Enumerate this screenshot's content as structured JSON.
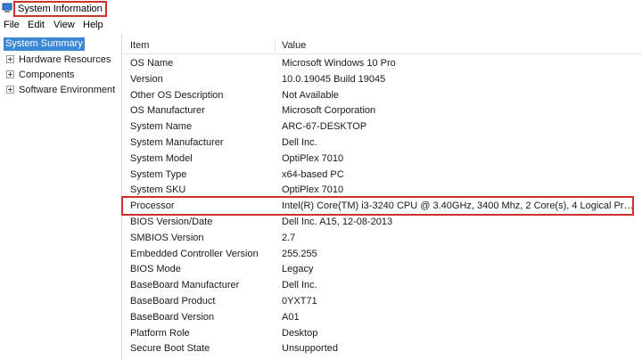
{
  "window": {
    "title": "System Information",
    "icon": "system-information-icon"
  },
  "menu": [
    {
      "label": "File"
    },
    {
      "label": "Edit"
    },
    {
      "label": "View"
    },
    {
      "label": "Help"
    }
  ],
  "tree": {
    "selected": "System Summary",
    "nodes": [
      {
        "label": "Hardware Resources"
      },
      {
        "label": "Components"
      },
      {
        "label": "Software Environment"
      }
    ]
  },
  "table": {
    "columns": [
      "Item",
      "Value"
    ],
    "rows": [
      [
        "OS Name",
        "Microsoft Windows 10 Pro"
      ],
      [
        "Version",
        "10.0.19045 Build 19045"
      ],
      [
        "Other OS Description",
        "Not Available"
      ],
      [
        "OS Manufacturer",
        "Microsoft Corporation"
      ],
      [
        "System Name",
        "ARC-67-DESKTOP"
      ],
      [
        "System Manufacturer",
        "Dell Inc."
      ],
      [
        "System Model",
        "OptiPlex 7010"
      ],
      [
        "System Type",
        "x64-based PC"
      ],
      [
        "System SKU",
        "OptiPlex 7010"
      ],
      [
        "Processor",
        "Intel(R) Core(TM) i3-3240 CPU @ 3.40GHz, 3400 Mhz, 2 Core(s), 4 Logical Pro..."
      ],
      [
        "BIOS Version/Date",
        "Dell Inc. A15, 12-08-2013"
      ],
      [
        "SMBIOS Version",
        "2.7"
      ],
      [
        "Embedded Controller Version",
        "255.255"
      ],
      [
        "BIOS Mode",
        "Legacy"
      ],
      [
        "BaseBoard Manufacturer",
        "Dell Inc."
      ],
      [
        "BaseBoard Product",
        "0YXT71"
      ],
      [
        "BaseBoard Version",
        "A01"
      ],
      [
        "Platform Role",
        "Desktop"
      ],
      [
        "Secure Boot State",
        "Unsupported"
      ]
    ]
  },
  "colors": {
    "highlight": "#d0312d",
    "selection": "#3b88d6"
  }
}
